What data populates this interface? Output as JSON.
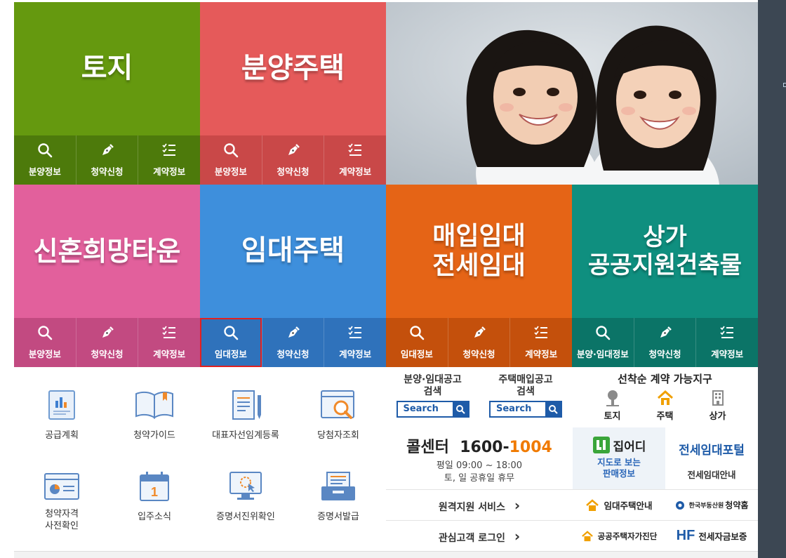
{
  "colors": {
    "land": "#65990f",
    "land_btn": "#4d7a0b",
    "sale": "#e55a5a",
    "sale_btn": "#c94848",
    "newlywed": "#e2609c",
    "newlywed_btn": "#c24a81",
    "rental": "#3e8fdc",
    "rental_btn": "#2f72bb",
    "purchase": "#e56416",
    "purchase_btn": "#c4500c",
    "commercial": "#0f8f7f",
    "commercial_btn": "#0b7467",
    "right_panel": "#3c4753",
    "call_accent": "#f07a00",
    "search_blue": "#1e5ba8"
  },
  "tiles": {
    "land": {
      "title": "토지",
      "buttons": [
        {
          "label": "분양정보",
          "icon": "search-icon"
        },
        {
          "label": "청약신청",
          "icon": "pen-icon"
        },
        {
          "label": "계약정보",
          "icon": "list-icon"
        }
      ]
    },
    "sale": {
      "title": "분양주택",
      "buttons": [
        {
          "label": "분양정보",
          "icon": "search-icon"
        },
        {
          "label": "청약신청",
          "icon": "pen-icon"
        },
        {
          "label": "계약정보",
          "icon": "list-icon"
        }
      ]
    },
    "newlywed": {
      "title": "신혼희망타운",
      "buttons": [
        {
          "label": "분양정보",
          "icon": "search-icon"
        },
        {
          "label": "청약신청",
          "icon": "pen-icon"
        },
        {
          "label": "계약정보",
          "icon": "list-icon"
        }
      ]
    },
    "rental": {
      "title": "임대주택",
      "buttons": [
        {
          "label": "임대정보",
          "icon": "search-icon"
        },
        {
          "label": "청약신청",
          "icon": "pen-icon"
        },
        {
          "label": "계약정보",
          "icon": "list-icon"
        }
      ]
    },
    "purchase": {
      "title": "매입임대\n전세임대",
      "buttons": [
        {
          "label": "임대정보",
          "icon": "search-icon"
        },
        {
          "label": "청약신청",
          "icon": "pen-icon"
        },
        {
          "label": "계약정보",
          "icon": "list-icon"
        }
      ]
    },
    "commercial": {
      "title": "상가\n공공지원건축물",
      "buttons": [
        {
          "label": "분양·임대정보",
          "icon": "search-icon"
        },
        {
          "label": "청약신청",
          "icon": "pen-icon"
        },
        {
          "label": "계약정보",
          "icon": "list-icon"
        }
      ]
    }
  },
  "utilities": [
    {
      "label": "공급계획",
      "icon": "supply-plan-icon"
    },
    {
      "label": "청약가이드",
      "icon": "book-icon"
    },
    {
      "label": "대표자선임계등록",
      "icon": "document-pen-icon"
    },
    {
      "label": "당첨자조회",
      "icon": "winner-search-icon"
    },
    {
      "label": "청약자격\n사전확인",
      "icon": "qualification-icon"
    },
    {
      "label": "입주소식",
      "icon": "calendar-icon"
    },
    {
      "label": "증명서진위확인",
      "icon": "monitor-cursor-icon"
    },
    {
      "label": "증명서발급",
      "icon": "certificate-tray-icon"
    }
  ],
  "search": {
    "sale_rental_notice": "분양·임대공고\n검색",
    "purchase_notice": "주택매입공고\n검색",
    "button_label": "Search"
  },
  "first_come": {
    "title": "선착순 계약 가능지구",
    "items": [
      {
        "label": "토지",
        "icon": "tree-icon"
      },
      {
        "label": "주택",
        "icon": "house-icon"
      },
      {
        "label": "상가",
        "icon": "building-icon"
      }
    ]
  },
  "call_center": {
    "label": "콜센터",
    "number_a": "1600-",
    "number_b": "1004",
    "hours": "평일 09:00 ~ 18:00\n토, 일 공휴일 휴무"
  },
  "links": {
    "remote": "원격지원 서비스",
    "login": "관심고객 로그인",
    "chevron": "›"
  },
  "banners": {
    "zipeodi_brand": "집어디",
    "zipeodi_sub": "지도로 보는\n판매정보",
    "jeonse_portal": "전세임대포털",
    "jeonse_portal_sub": "전세임대안내",
    "rental_guide": "임대주택안내",
    "reb_text": "한국부동산원",
    "reb_bold": "청약홈",
    "public_price": "공공주택자가진단",
    "hf_logo": "HF",
    "jeonse_guarantee": "전세자금보증"
  }
}
